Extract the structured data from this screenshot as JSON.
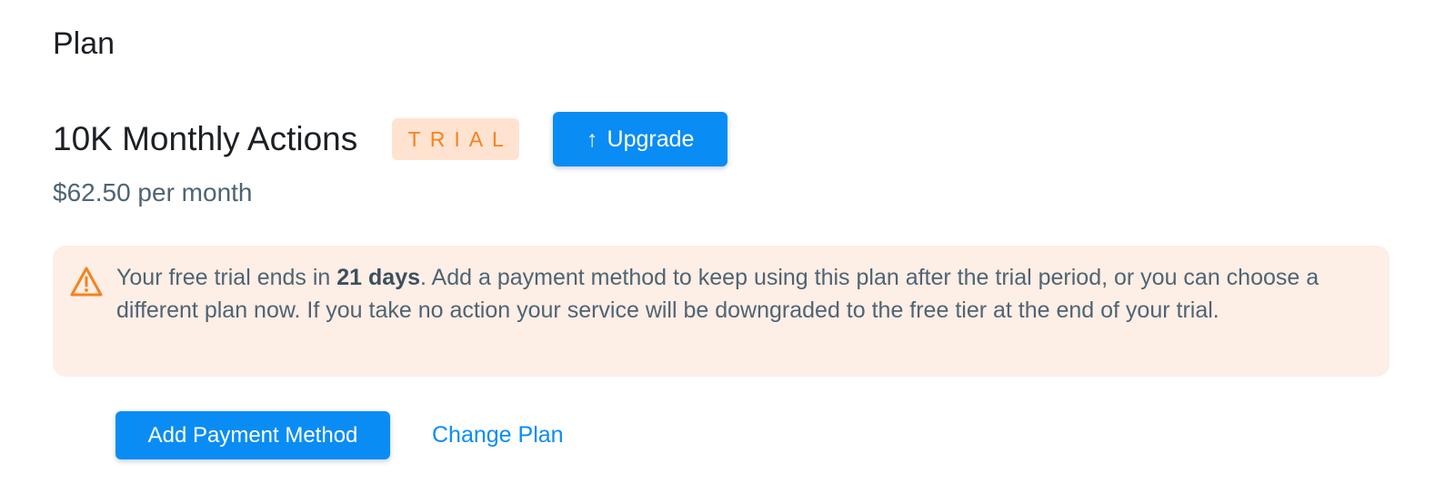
{
  "section": {
    "title": "Plan"
  },
  "plan": {
    "name": "10K Monthly Actions",
    "badge": "TRIAL",
    "upgrade_label": "Upgrade",
    "upgrade_icon": "arrow-up-icon",
    "price": "$62.50 per month"
  },
  "notice": {
    "icon": "warning-triangle-icon",
    "text_before": "Your free trial ends in ",
    "text_bold": "21 days",
    "text_after": ". Add a payment method to keep using this plan after the trial period, or you can choose a different plan now. If you take no action your service will be downgraded to the free tier at the end of your trial."
  },
  "actions": {
    "add_payment_label": "Add Payment Method",
    "change_plan_label": "Change Plan"
  },
  "colors": {
    "accent": "#0a8cf5",
    "badge_bg": "#ffe3d0",
    "badge_text": "#f5821f",
    "notice_bg": "#fdeee6",
    "warning_icon": "#f5821f"
  }
}
